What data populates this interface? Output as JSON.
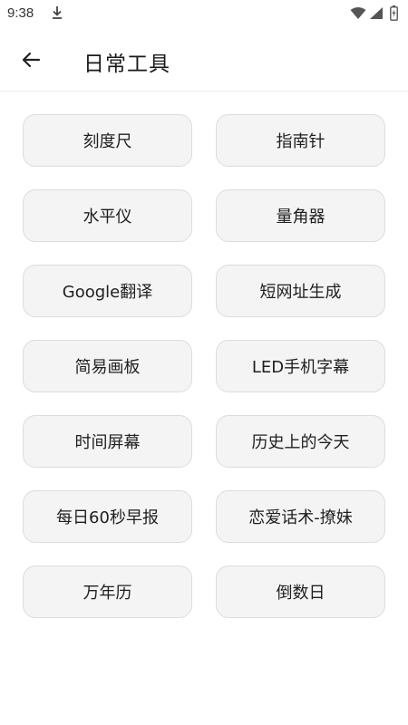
{
  "status_bar": {
    "time": "9:38",
    "icons": [
      "download-icon",
      "wifi-icon",
      "signal-icon",
      "battery-icon"
    ]
  },
  "header": {
    "title": "日常工具",
    "back_icon": "arrow-left-icon"
  },
  "tools": [
    {
      "label": "刻度尺"
    },
    {
      "label": "指南针"
    },
    {
      "label": "水平仪"
    },
    {
      "label": "量角器"
    },
    {
      "label": "Google翻译"
    },
    {
      "label": "短网址生成"
    },
    {
      "label": "简易画板"
    },
    {
      "label": "LED手机字幕"
    },
    {
      "label": "时间屏幕"
    },
    {
      "label": "历史上的今天"
    },
    {
      "label": "每日60秒早报"
    },
    {
      "label": "恋爱话术-撩妹"
    },
    {
      "label": "万年历"
    },
    {
      "label": "倒数日"
    }
  ],
  "colors": {
    "button_bg": "#f4f4f4",
    "button_border": "#dcdcdc",
    "text": "#1f1f1f"
  }
}
